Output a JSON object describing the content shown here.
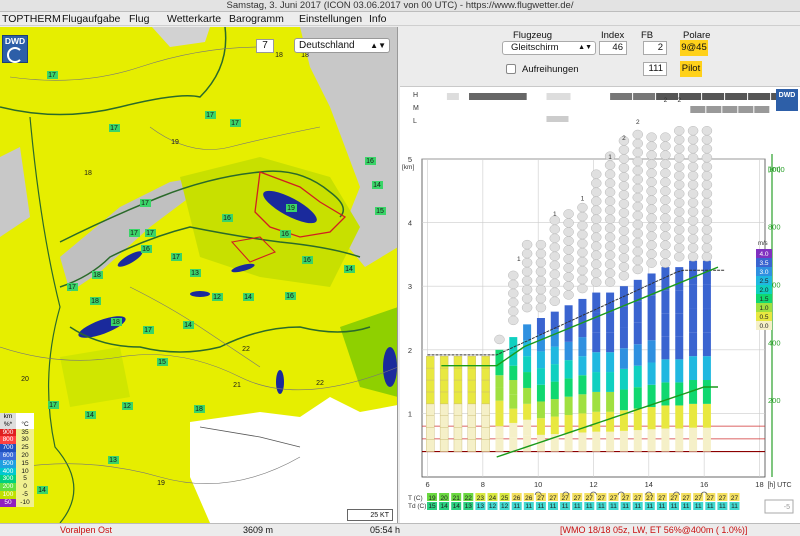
{
  "window": {
    "title": "Samstag, 3. Juni 2017 (ICON 03.06.2017 von 00 UTC) - https://www.flugwetter.de/"
  },
  "menu": [
    "TOPTHERM",
    "Flugaufgabe",
    "Flug",
    "Wetterkarte",
    "Barogramm",
    "Einstellungen",
    "Info"
  ],
  "map": {
    "logo": "DWD",
    "zoom_value": "7",
    "region": "Deutschland",
    "scale_label": "25 KT",
    "legend_header": [
      "km",
      "°C"
    ],
    "legend_sub": [
      "%*",
      "°C"
    ],
    "legend_rows": [
      {
        "km": "900",
        "c": "35",
        "color": "#e02020"
      },
      {
        "km": "800",
        "c": "30",
        "color": "#ff4040"
      },
      {
        "km": "700",
        "c": "25",
        "color": "#2050c0"
      },
      {
        "km": "600",
        "c": "20",
        "color": "#3c6cd8"
      },
      {
        "km": "500",
        "c": "15",
        "color": "#20a0e0"
      },
      {
        "km": "400",
        "c": "10",
        "color": "#00c8d0"
      },
      {
        "km": "300",
        "c": "5",
        "color": "#00d080"
      },
      {
        "km": "200",
        "c": "0",
        "color": "#60e040"
      },
      {
        "km": "100",
        "c": "-5",
        "color": "#c0e000"
      },
      {
        "km": "50",
        "c": "-10",
        "color": "#9020c0"
      }
    ],
    "values": [
      {
        "v": "17",
        "x": 52,
        "y": 50,
        "bg": "green"
      },
      {
        "v": "18",
        "x": 88,
        "y": 148,
        "bg": "none"
      },
      {
        "v": "17",
        "x": 114,
        "y": 103,
        "bg": "green"
      },
      {
        "v": "19",
        "x": 175,
        "y": 117,
        "bg": "none"
      },
      {
        "v": "17",
        "x": 134,
        "y": 208,
        "bg": "green"
      },
      {
        "v": "17",
        "x": 210,
        "y": 90,
        "bg": "green"
      },
      {
        "v": "17",
        "x": 235,
        "y": 98,
        "bg": "green"
      },
      {
        "v": "16",
        "x": 370,
        "y": 136,
        "bg": "green"
      },
      {
        "v": "14",
        "x": 377,
        "y": 160,
        "bg": "green"
      },
      {
        "v": "15",
        "x": 380,
        "y": 186,
        "bg": "green"
      },
      {
        "v": "17",
        "x": 145,
        "y": 178,
        "bg": "green"
      },
      {
        "v": "17",
        "x": 150,
        "y": 208,
        "bg": "green"
      },
      {
        "v": "16",
        "x": 227,
        "y": 193,
        "bg": "green"
      },
      {
        "v": "19",
        "x": 291,
        "y": 183,
        "bg": "green"
      },
      {
        "v": "16",
        "x": 146,
        "y": 224,
        "bg": "green"
      },
      {
        "v": "17",
        "x": 176,
        "y": 232,
        "bg": "green"
      },
      {
        "v": "16",
        "x": 285,
        "y": 209,
        "bg": "green"
      },
      {
        "v": "13",
        "x": 195,
        "y": 248,
        "bg": "green"
      },
      {
        "v": "16",
        "x": 307,
        "y": 235,
        "bg": "green"
      },
      {
        "v": "14",
        "x": 349,
        "y": 244,
        "bg": "green"
      },
      {
        "v": "17",
        "x": 72,
        "y": 262,
        "bg": "green"
      },
      {
        "v": "18",
        "x": 97,
        "y": 250,
        "bg": "green"
      },
      {
        "v": "12",
        "x": 217,
        "y": 272,
        "bg": "green"
      },
      {
        "v": "14",
        "x": 248,
        "y": 272,
        "bg": "green"
      },
      {
        "v": "18",
        "x": 95,
        "y": 276,
        "bg": "green"
      },
      {
        "v": "16",
        "x": 290,
        "y": 271,
        "bg": "green"
      },
      {
        "v": "17",
        "x": 148,
        "y": 305,
        "bg": "green"
      },
      {
        "v": "18",
        "x": 116,
        "y": 297,
        "bg": "green"
      },
      {
        "v": "14",
        "x": 188,
        "y": 300,
        "bg": "green"
      },
      {
        "v": "15",
        "x": 162,
        "y": 337,
        "bg": "green"
      },
      {
        "v": "22",
        "x": 246,
        "y": 324,
        "bg": "none"
      },
      {
        "v": "21",
        "x": 237,
        "y": 360,
        "bg": "none"
      },
      {
        "v": "22",
        "x": 320,
        "y": 358,
        "bg": "none"
      },
      {
        "v": "20",
        "x": 25,
        "y": 354,
        "bg": "none"
      },
      {
        "v": "17",
        "x": 53,
        "y": 380,
        "bg": "green"
      },
      {
        "v": "14",
        "x": 90,
        "y": 390,
        "bg": "green"
      },
      {
        "v": "12",
        "x": 127,
        "y": 381,
        "bg": "green"
      },
      {
        "v": "18",
        "x": 199,
        "y": 384,
        "bg": "green"
      },
      {
        "v": "13",
        "x": 113,
        "y": 435,
        "bg": "green"
      },
      {
        "v": "14",
        "x": 42,
        "y": 465,
        "bg": "green"
      },
      {
        "v": "19",
        "x": 161,
        "y": 458,
        "bg": "none"
      },
      {
        "v": "18",
        "x": 279,
        "y": 30,
        "bg": "none"
      },
      {
        "v": "18",
        "x": 305,
        "y": 30,
        "bg": "none"
      }
    ]
  },
  "controls": {
    "flugzeug_label": "Flugzeug",
    "flugzeug_value": "Gleitschirm",
    "index_label": "Index",
    "index_value": "46",
    "fb_label": "FB",
    "fb_value": "2",
    "polare_label": "Polare",
    "polare_value": "9@45",
    "aufreihungen_label": "Aufreihungen",
    "aufreihungen_value": "111",
    "pilot_label": "Pilot"
  },
  "meteogram": {
    "logo": "DWD",
    "row_labels": [
      "H",
      "M",
      "L"
    ],
    "y_left_unit": "[km]",
    "y_left_ticks": [
      "5",
      "4",
      "3",
      "2",
      "1"
    ],
    "y_right_unit": "[km]",
    "y_right_ticks": [
      "1000",
      "800",
      "600",
      "400",
      "200"
    ],
    "x_ticks": [
      "6",
      "8",
      "10",
      "12",
      "14",
      "16",
      "18"
    ],
    "x_unit": "[h] UTC",
    "ms_legend_header": "m/s",
    "ms_legend": [
      {
        "v": "4.0",
        "color": "#8030c0"
      },
      {
        "v": "3.5",
        "color": "#3a64d0"
      },
      {
        "v": "3.0",
        "color": "#2f90e0"
      },
      {
        "v": "2.5",
        "color": "#20b8e0"
      },
      {
        "v": "2.0",
        "color": "#10d0c0"
      },
      {
        "v": "1.5",
        "color": "#10d870"
      },
      {
        "v": "1.0",
        "color": "#a0e040"
      },
      {
        "v": "0.5",
        "color": "#e8e840"
      },
      {
        "v": "0.0",
        "color": "#f5f0c8"
      }
    ],
    "t_label": "T (C)",
    "td_label": "Td (C)",
    "t_values": [
      "19",
      "20",
      "21",
      "22",
      "23",
      "24",
      "25",
      "26",
      "26",
      "27",
      "27",
      "27",
      "27",
      "27",
      "27",
      "27",
      "27",
      "27",
      "27",
      "27",
      "27",
      "27",
      "27",
      "27",
      "27",
      "27"
    ],
    "td_values": [
      "15",
      "14",
      "14",
      "13",
      "13",
      "12",
      "12",
      "11",
      "11",
      "11",
      "11",
      "11",
      "11",
      "11",
      "11",
      "11",
      "11",
      "11",
      "11",
      "11",
      "11",
      "11",
      "11",
      "11",
      "11",
      "11"
    ],
    "bottom_value": "-5"
  },
  "status": {
    "region": "Voralpen Ost",
    "altitude": "3609 m",
    "time": "05:54 h",
    "info": "[WMO 18/18 05z, LW, ET  56%@400m ( 1.0%)]"
  }
}
